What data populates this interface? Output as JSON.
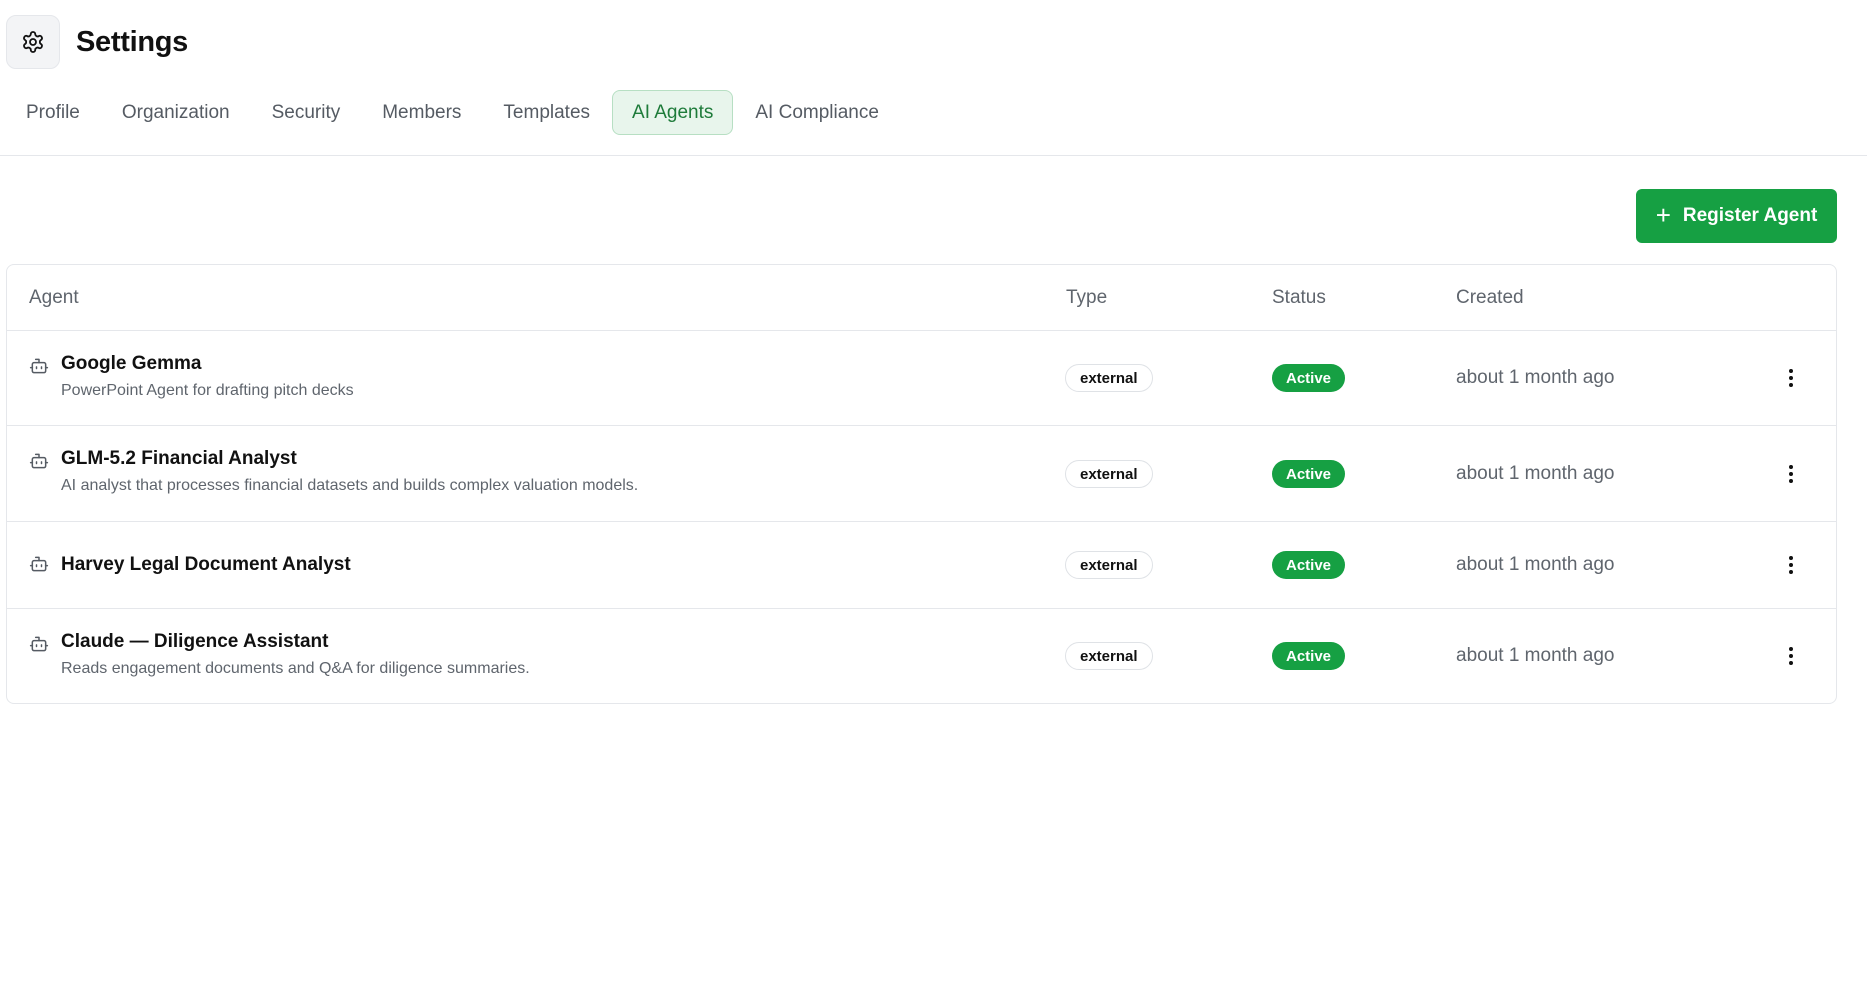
{
  "page": {
    "title": "Settings"
  },
  "tabs": [
    {
      "label": "Profile"
    },
    {
      "label": "Organization"
    },
    {
      "label": "Security"
    },
    {
      "label": "Members"
    },
    {
      "label": "Templates"
    },
    {
      "label": "AI Agents",
      "active": true
    },
    {
      "label": "AI Compliance"
    }
  ],
  "actions": {
    "register_label": "Register Agent"
  },
  "table": {
    "columns": [
      "Agent",
      "Type",
      "Status",
      "Created"
    ],
    "rows": [
      {
        "name": "Google Gemma",
        "description": "PowerPoint Agent for drafting pitch decks",
        "type": "external",
        "status": "Active",
        "created": "about 1 month ago"
      },
      {
        "name": "GLM-5.2 Financial Analyst",
        "description": "AI analyst that processes financial datasets and builds complex valuation models.",
        "type": "external",
        "status": "Active",
        "created": "about 1 month ago"
      },
      {
        "name": "Harvey Legal Document Analyst",
        "description": "",
        "type": "external",
        "status": "Active",
        "created": "about 1 month ago"
      },
      {
        "name": "Claude — Diligence Assistant",
        "description": "Reads engagement documents and Q&A for diligence summaries.",
        "type": "external",
        "status": "Active",
        "created": "about 1 month ago"
      }
    ]
  },
  "colors": {
    "accent": "#16a043",
    "active_tab_bg": "#e8f5ec",
    "active_tab_text": "#1e7b3a",
    "border": "#e5e7eb"
  },
  "icons": {
    "settings": "gear-icon",
    "agent": "bot-icon",
    "row_menu": "more-vertical-icon",
    "add": "plus-icon"
  }
}
